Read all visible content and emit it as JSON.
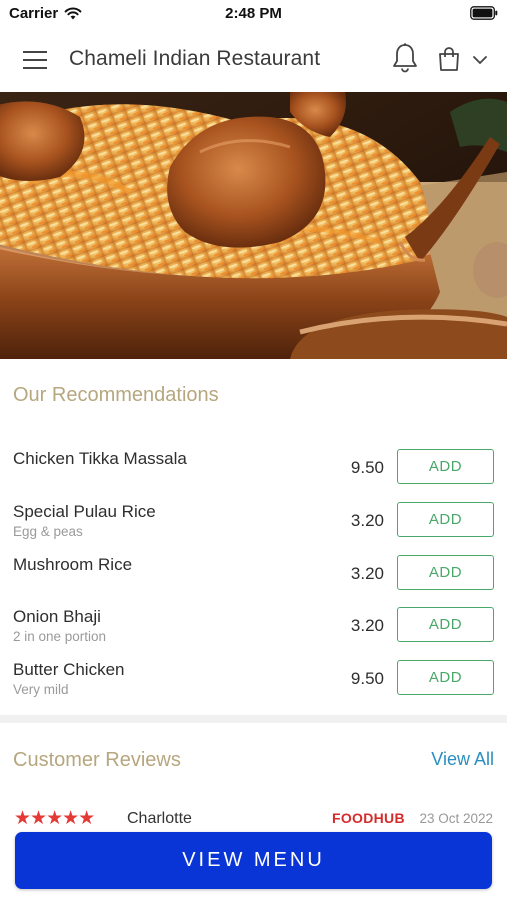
{
  "status_bar": {
    "carrier": "Carrier",
    "time": "2:48 PM"
  },
  "header": {
    "title": "Chameli Indian Restaurant"
  },
  "icons": {
    "menu": "hamburger-icon",
    "notifications": "bell-icon",
    "cart": "shopping-bag-icon",
    "dropdown": "chevron-down-icon"
  },
  "recommendations": {
    "title": "Our Recommendations",
    "items": [
      {
        "name": "Chicken Tikka Massala",
        "description": "",
        "price": "9.50",
        "button": "ADD"
      },
      {
        "name": "Special Pulau Rice",
        "description": "Egg & peas",
        "price": "3.20",
        "button": "ADD"
      },
      {
        "name": "Mushroom Rice",
        "description": "",
        "price": "3.20",
        "button": "ADD"
      },
      {
        "name": "Onion Bhaji",
        "description": "2 in one portion",
        "price": "3.20",
        "button": "ADD"
      },
      {
        "name": "Butter Chicken",
        "description": "Very mild",
        "price": "9.50",
        "button": "ADD"
      }
    ]
  },
  "reviews": {
    "title": "Customer Reviews",
    "view_all": "View All",
    "items": [
      {
        "stars": "★★★★★",
        "rating": 5,
        "reviewer": "Charlotte",
        "source": "FOODHUB",
        "date": "23 Oct 2022"
      }
    ]
  },
  "cta": {
    "label": "VIEW MENU"
  },
  "colors": {
    "accent_blue": "#0a35d6",
    "add_green": "#4aa76a",
    "section_title": "#b6a77f",
    "link_blue": "#2a8fc0",
    "star_red": "#e53935"
  }
}
